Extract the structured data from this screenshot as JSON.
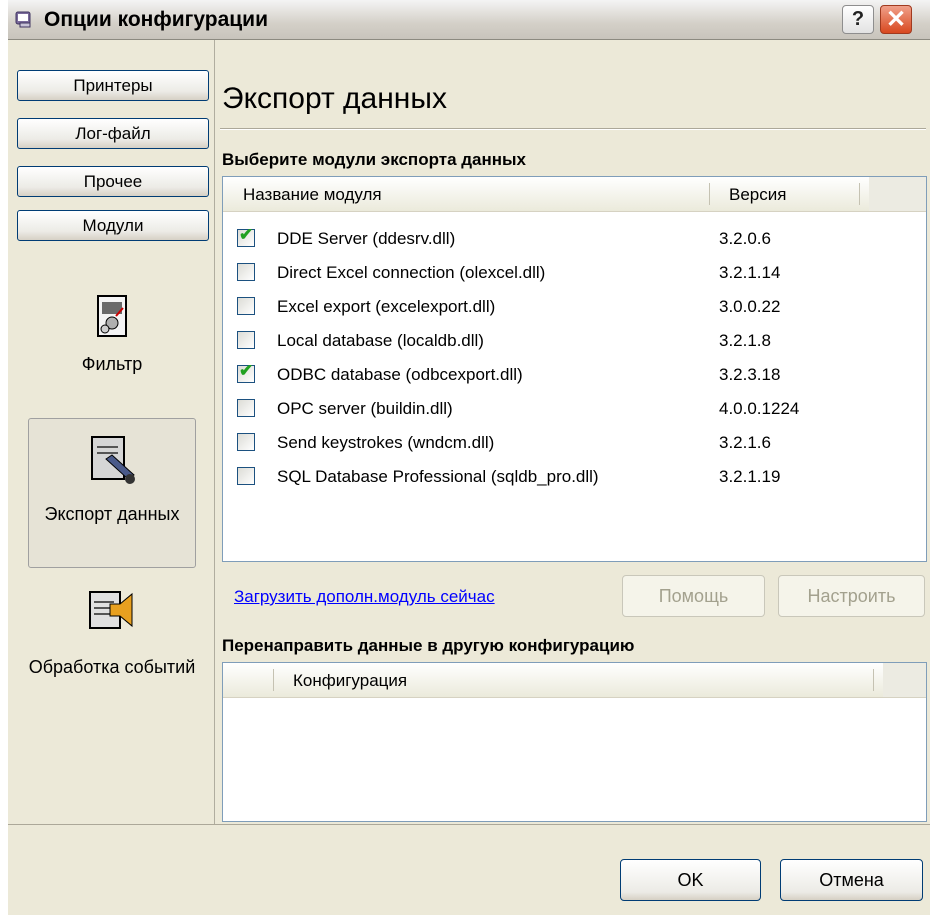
{
  "window": {
    "title": "Опции конфигурации",
    "help_glyph": "?",
    "close_glyph": "✕"
  },
  "nav": {
    "tabs": [
      {
        "label": "Принтеры"
      },
      {
        "label": "Лог-файл"
      },
      {
        "label": "Прочее"
      },
      {
        "label": "Модули"
      }
    ],
    "items": [
      {
        "label": "Фильтр",
        "icon": "filter-icon"
      },
      {
        "label": "Экспорт данных",
        "icon": "data-export-icon",
        "selected": true
      },
      {
        "label": "Обработка событий",
        "icon": "event-handling-icon"
      }
    ]
  },
  "page": {
    "title": "Экспорт данных",
    "modules_section": "Выберите модули экспорта данных",
    "modules_table": {
      "columns": [
        "Название модуля",
        "Версия"
      ],
      "rows": [
        {
          "name": "DDE Server (ddesrv.dll)",
          "version": "3.2.0.6",
          "checked": true
        },
        {
          "name": "Direct Excel connection (olexcel.dll)",
          "version": "3.2.1.14",
          "checked": false
        },
        {
          "name": "Excel export (excelexport.dll)",
          "version": "3.0.0.22",
          "checked": false
        },
        {
          "name": "Local database (localdb.dll)",
          "version": "3.2.1.8",
          "checked": false
        },
        {
          "name": "ODBC database (odbcexport.dll)",
          "version": "3.2.3.18",
          "checked": true
        },
        {
          "name": "OPC server (buildin.dll)",
          "version": "4.0.0.1224",
          "checked": false
        },
        {
          "name": "Send keystrokes (wndcm.dll)",
          "version": "3.2.1.6",
          "checked": false
        },
        {
          "name": "SQL Database Professional (sqldb_pro.dll)",
          "version": "3.2.1.19",
          "checked": false
        }
      ]
    },
    "load_link": "Загрузить дополн.модуль сейчас",
    "help_button": "Помощь",
    "configure_button": "Настроить",
    "redirect_section": "Перенаправить данные в другую конфигурацию",
    "config_table": {
      "columns": [
        "Конфигурация"
      ]
    }
  },
  "footer": {
    "ok": "OK",
    "cancel": "Отмена"
  },
  "colors": {
    "accent_border": "#003c74",
    "check": "#21a121",
    "list_border": "#7f9db9",
    "close": "#d8481f"
  }
}
